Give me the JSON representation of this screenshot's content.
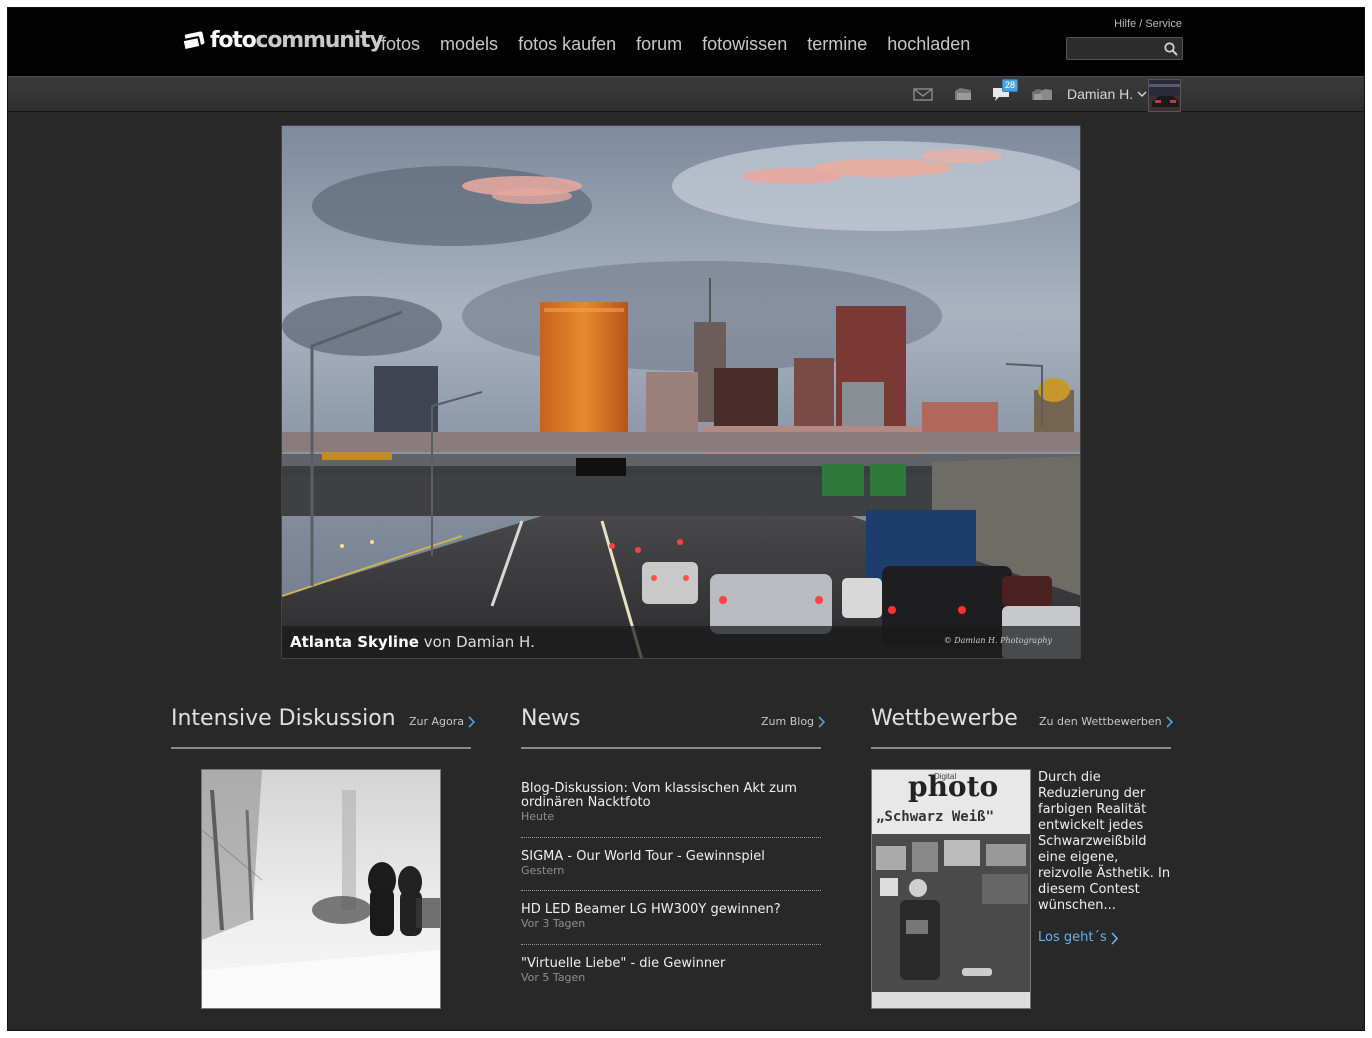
{
  "header": {
    "logo_part1": "foto",
    "logo_part2": "community",
    "nav": [
      "fotos",
      "models",
      "fotos kaufen",
      "forum",
      "fotowissen",
      "termine",
      "hochladen"
    ],
    "help_link": "Hilfe / Service",
    "search_placeholder": ""
  },
  "userbar": {
    "message_count": "28",
    "username": "Damian H.",
    "icons": [
      "mail-icon",
      "folder-icon",
      "comments-icon",
      "folders-icon"
    ]
  },
  "featured": {
    "title": "Atlanta Skyline",
    "by": "von",
    "author": "Damian H.",
    "credit": "© Damian H. Photography"
  },
  "sections": {
    "discussion": {
      "title": "Intensive Diskussion",
      "link": "Zur Agora"
    },
    "news": {
      "title": "News",
      "link": "Zum Blog",
      "items": [
        {
          "title": "Blog-Diskussion: Vom klassischen Akt zum ordinären Nacktfoto",
          "date": "Heute"
        },
        {
          "title": "SIGMA - Our World Tour - Gewinnspiel",
          "date": "Gestern"
        },
        {
          "title": "HD LED Beamer LG HW300Y gewinnen?",
          "date": "Vor 3 Tagen"
        },
        {
          "title": "\"Virtuelle Liebe\" - die Gewinner",
          "date": "Vor 5 Tagen"
        }
      ]
    },
    "contests": {
      "title": "Wettbewerbe",
      "link": "Zu den Wettbewerben",
      "magazine_small": "Digital",
      "magazine_title": "photo",
      "magazine_subtitle": "„Schwarz Weiß\"",
      "description": "Durch die Reduzierung der farbigen Realität entwickelt jedes Schwarzweißbild eine eigene, reizvolle Ästhetik. In diesem Contest wünschen...",
      "cta": "Los geht´s"
    }
  },
  "colors": {
    "background": "#282828",
    "topbar": "#020202",
    "accent_link": "#69b3ec",
    "badge": "#4aa3dd"
  }
}
